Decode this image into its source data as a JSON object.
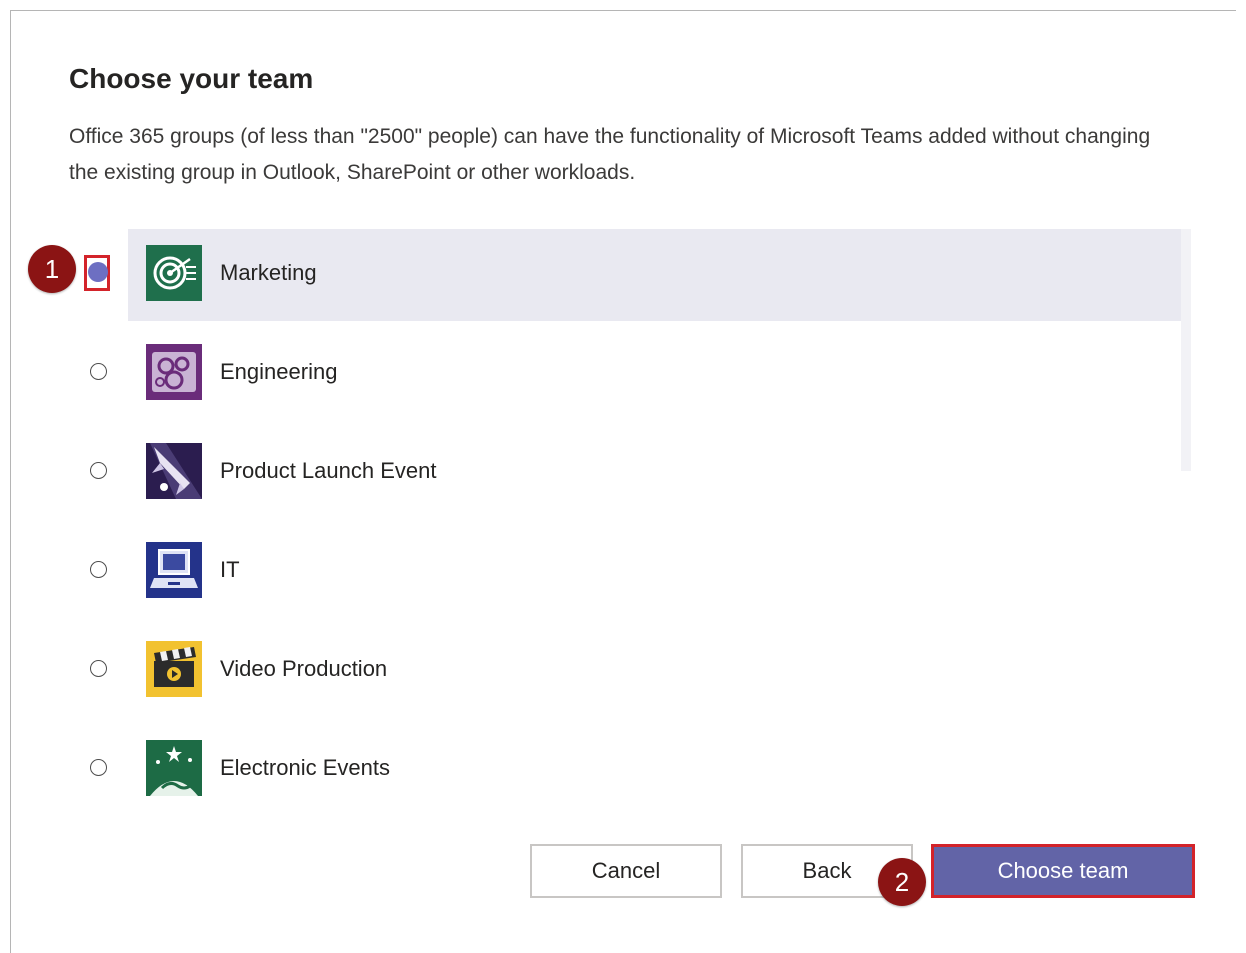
{
  "dialog": {
    "title": "Choose your team",
    "description": "Office 365 groups (of less than \"2500\" people) can have the functionality of Microsoft Teams added without changing the existing group in Outlook, SharePoint or other workloads."
  },
  "teams": [
    {
      "name": "Marketing",
      "selected": true,
      "icon": "target-icon",
      "color": "#1f6f4c"
    },
    {
      "name": "Engineering",
      "selected": false,
      "icon": "gears-icon",
      "color": "#6a2c7a"
    },
    {
      "name": "Product Launch Event",
      "selected": false,
      "icon": "rocket-icon",
      "color": "#2b1d4f"
    },
    {
      "name": "IT",
      "selected": false,
      "icon": "laptop-icon",
      "color": "#24338a"
    },
    {
      "name": "Video Production",
      "selected": false,
      "icon": "clapperboard-icon",
      "color": "#f2c230"
    },
    {
      "name": "Electronic Events",
      "selected": false,
      "icon": "globe-stars-icon",
      "color": "#1d6b45"
    }
  ],
  "annotations": {
    "step1": "1",
    "step2": "2"
  },
  "buttons": {
    "cancel": "Cancel",
    "back": "Back",
    "choose": "Choose team"
  },
  "colors": {
    "accent": "#6264a7",
    "highlight": "#d3232a",
    "badge": "#8b1414"
  }
}
